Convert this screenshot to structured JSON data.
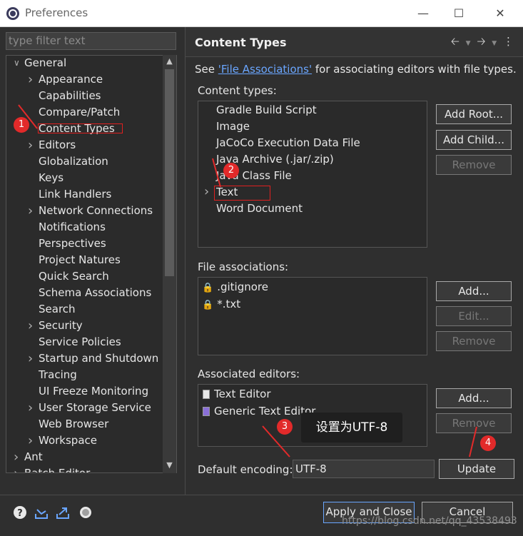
{
  "window": {
    "title": "Preferences"
  },
  "filter": {
    "placeholder": "type filter text"
  },
  "tree": {
    "items": [
      {
        "label": "General",
        "expanded": true,
        "level": 0
      },
      {
        "label": "Appearance",
        "level": 1,
        "has_children": true
      },
      {
        "label": "Capabilities",
        "level": 1
      },
      {
        "label": "Compare/Patch",
        "level": 1
      },
      {
        "label": "Content Types",
        "level": 1,
        "selected": true
      },
      {
        "label": "Editors",
        "level": 1,
        "has_children": true
      },
      {
        "label": "Globalization",
        "level": 1
      },
      {
        "label": "Keys",
        "level": 1
      },
      {
        "label": "Link Handlers",
        "level": 1
      },
      {
        "label": "Network Connections",
        "level": 1,
        "has_children": true
      },
      {
        "label": "Notifications",
        "level": 1
      },
      {
        "label": "Perspectives",
        "level": 1
      },
      {
        "label": "Project Natures",
        "level": 1
      },
      {
        "label": "Quick Search",
        "level": 1
      },
      {
        "label": "Schema Associations",
        "level": 1
      },
      {
        "label": "Search",
        "level": 1
      },
      {
        "label": "Security",
        "level": 1,
        "has_children": true
      },
      {
        "label": "Service Policies",
        "level": 1
      },
      {
        "label": "Startup and Shutdown",
        "level": 1,
        "has_children": true
      },
      {
        "label": "Tracing",
        "level": 1
      },
      {
        "label": "UI Freeze Monitoring",
        "level": 1
      },
      {
        "label": "User Storage Service",
        "level": 1,
        "has_children": true
      },
      {
        "label": "Web Browser",
        "level": 1
      },
      {
        "label": "Workspace",
        "level": 1,
        "has_children": true
      },
      {
        "label": "Ant",
        "level": 0,
        "has_children": true
      },
      {
        "label": "Batch Editor",
        "level": 0,
        "has_children": true
      }
    ]
  },
  "main": {
    "title": "Content Types",
    "see_prefix": "See ",
    "see_link": "'File Associations'",
    "see_suffix": " for associating editors with file types.",
    "content_types_label": "Content types:",
    "content_types": [
      "Gradle Build Script",
      "Image",
      "JaCoCo Execution Data File",
      "Java Archive (.jar/.zip)",
      "Java Class File",
      "Text",
      "Word Document"
    ],
    "add_root": "Add Root...",
    "add_child": "Add Child...",
    "remove": "Remove",
    "file_assoc_label": "File associations:",
    "file_associations": [
      ".gitignore",
      "*.txt"
    ],
    "add": "Add...",
    "edit": "Edit...",
    "assoc_editors_label": "Associated editors:",
    "associated_editors": [
      "Text Editor",
      "Generic Text Editor"
    ],
    "default_encoding_label": "Default encoding:",
    "default_encoding_value": "UTF-8",
    "update": "Update"
  },
  "footer": {
    "apply_close": "Apply and Close",
    "cancel": "Cancel",
    "watermark": "https://blog.csdn.net/qq_43538493"
  },
  "annotations": {
    "tooltip": "设置为UTF-8",
    "markers": [
      "1",
      "2",
      "3",
      "4"
    ],
    "accent_color": "#e22a2a"
  },
  "icons": [
    "app-icon",
    "help-icon",
    "import-icon",
    "export-icon",
    "record-icon",
    "lock-icon",
    "text-editor-icon",
    "generic-editor-icon"
  ]
}
